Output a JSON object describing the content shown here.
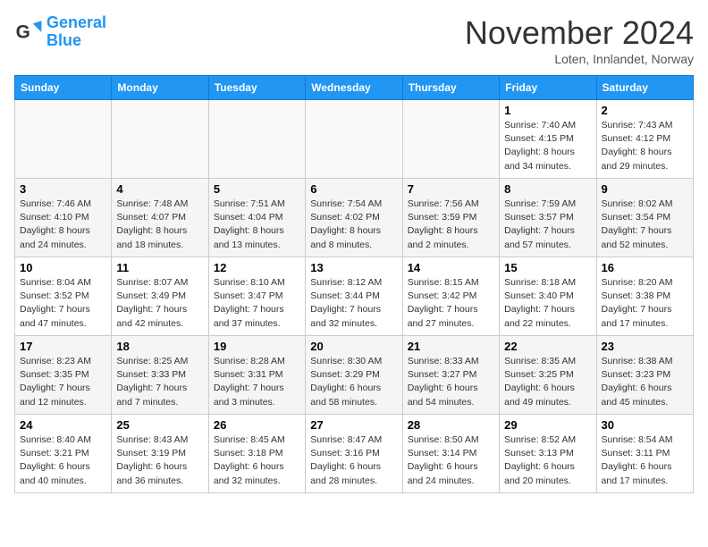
{
  "logo": {
    "line1": "General",
    "line2": "Blue"
  },
  "title": {
    "month_year": "November 2024",
    "location": "Loten, Innlandet, Norway"
  },
  "headers": [
    "Sunday",
    "Monday",
    "Tuesday",
    "Wednesday",
    "Thursday",
    "Friday",
    "Saturday"
  ],
  "weeks": [
    [
      {
        "day": "",
        "info": ""
      },
      {
        "day": "",
        "info": ""
      },
      {
        "day": "",
        "info": ""
      },
      {
        "day": "",
        "info": ""
      },
      {
        "day": "",
        "info": ""
      },
      {
        "day": "1",
        "info": "Sunrise: 7:40 AM\nSunset: 4:15 PM\nDaylight: 8 hours\nand 34 minutes."
      },
      {
        "day": "2",
        "info": "Sunrise: 7:43 AM\nSunset: 4:12 PM\nDaylight: 8 hours\nand 29 minutes."
      }
    ],
    [
      {
        "day": "3",
        "info": "Sunrise: 7:46 AM\nSunset: 4:10 PM\nDaylight: 8 hours\nand 24 minutes."
      },
      {
        "day": "4",
        "info": "Sunrise: 7:48 AM\nSunset: 4:07 PM\nDaylight: 8 hours\nand 18 minutes."
      },
      {
        "day": "5",
        "info": "Sunrise: 7:51 AM\nSunset: 4:04 PM\nDaylight: 8 hours\nand 13 minutes."
      },
      {
        "day": "6",
        "info": "Sunrise: 7:54 AM\nSunset: 4:02 PM\nDaylight: 8 hours\nand 8 minutes."
      },
      {
        "day": "7",
        "info": "Sunrise: 7:56 AM\nSunset: 3:59 PM\nDaylight: 8 hours\nand 2 minutes."
      },
      {
        "day": "8",
        "info": "Sunrise: 7:59 AM\nSunset: 3:57 PM\nDaylight: 7 hours\nand 57 minutes."
      },
      {
        "day": "9",
        "info": "Sunrise: 8:02 AM\nSunset: 3:54 PM\nDaylight: 7 hours\nand 52 minutes."
      }
    ],
    [
      {
        "day": "10",
        "info": "Sunrise: 8:04 AM\nSunset: 3:52 PM\nDaylight: 7 hours\nand 47 minutes."
      },
      {
        "day": "11",
        "info": "Sunrise: 8:07 AM\nSunset: 3:49 PM\nDaylight: 7 hours\nand 42 minutes."
      },
      {
        "day": "12",
        "info": "Sunrise: 8:10 AM\nSunset: 3:47 PM\nDaylight: 7 hours\nand 37 minutes."
      },
      {
        "day": "13",
        "info": "Sunrise: 8:12 AM\nSunset: 3:44 PM\nDaylight: 7 hours\nand 32 minutes."
      },
      {
        "day": "14",
        "info": "Sunrise: 8:15 AM\nSunset: 3:42 PM\nDaylight: 7 hours\nand 27 minutes."
      },
      {
        "day": "15",
        "info": "Sunrise: 8:18 AM\nSunset: 3:40 PM\nDaylight: 7 hours\nand 22 minutes."
      },
      {
        "day": "16",
        "info": "Sunrise: 8:20 AM\nSunset: 3:38 PM\nDaylight: 7 hours\nand 17 minutes."
      }
    ],
    [
      {
        "day": "17",
        "info": "Sunrise: 8:23 AM\nSunset: 3:35 PM\nDaylight: 7 hours\nand 12 minutes."
      },
      {
        "day": "18",
        "info": "Sunrise: 8:25 AM\nSunset: 3:33 PM\nDaylight: 7 hours\nand 7 minutes."
      },
      {
        "day": "19",
        "info": "Sunrise: 8:28 AM\nSunset: 3:31 PM\nDaylight: 7 hours\nand 3 minutes."
      },
      {
        "day": "20",
        "info": "Sunrise: 8:30 AM\nSunset: 3:29 PM\nDaylight: 6 hours\nand 58 minutes."
      },
      {
        "day": "21",
        "info": "Sunrise: 8:33 AM\nSunset: 3:27 PM\nDaylight: 6 hours\nand 54 minutes."
      },
      {
        "day": "22",
        "info": "Sunrise: 8:35 AM\nSunset: 3:25 PM\nDaylight: 6 hours\nand 49 minutes."
      },
      {
        "day": "23",
        "info": "Sunrise: 8:38 AM\nSunset: 3:23 PM\nDaylight: 6 hours\nand 45 minutes."
      }
    ],
    [
      {
        "day": "24",
        "info": "Sunrise: 8:40 AM\nSunset: 3:21 PM\nDaylight: 6 hours\nand 40 minutes."
      },
      {
        "day": "25",
        "info": "Sunrise: 8:43 AM\nSunset: 3:19 PM\nDaylight: 6 hours\nand 36 minutes."
      },
      {
        "day": "26",
        "info": "Sunrise: 8:45 AM\nSunset: 3:18 PM\nDaylight: 6 hours\nand 32 minutes."
      },
      {
        "day": "27",
        "info": "Sunrise: 8:47 AM\nSunset: 3:16 PM\nDaylight: 6 hours\nand 28 minutes."
      },
      {
        "day": "28",
        "info": "Sunrise: 8:50 AM\nSunset: 3:14 PM\nDaylight: 6 hours\nand 24 minutes."
      },
      {
        "day": "29",
        "info": "Sunrise: 8:52 AM\nSunset: 3:13 PM\nDaylight: 6 hours\nand 20 minutes."
      },
      {
        "day": "30",
        "info": "Sunrise: 8:54 AM\nSunset: 3:11 PM\nDaylight: 6 hours\nand 17 minutes."
      }
    ]
  ]
}
